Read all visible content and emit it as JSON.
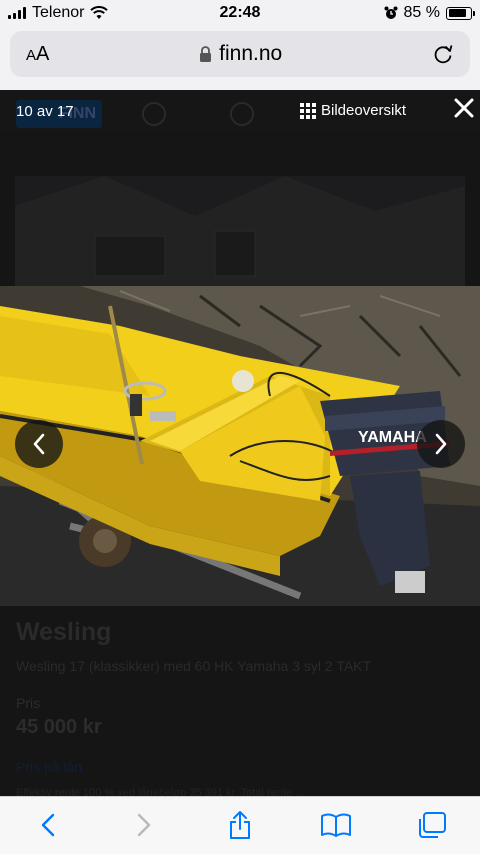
{
  "status_bar": {
    "carrier": "Telenor",
    "time": "22:48",
    "battery_text": "85 %",
    "battery_level": 0.85
  },
  "browser": {
    "text_size_small": "A",
    "text_size_large": "A",
    "domain": "finn.no"
  },
  "gallery": {
    "counter": "10 av 17",
    "overview_label": "Bildeoversikt"
  },
  "listing": {
    "title": "Wesling",
    "description": "Wesling 17 (klassikker) med 60 HK Yamaha 3 syl 2 TAKT",
    "price_label": "Pris",
    "price": "45 000 kr",
    "loan_link": "Pris på lån",
    "fine_print": "Effektiv rente 100 % ved lånebeløp 35 391 kr. Total rente ..."
  },
  "photo": {
    "engine_brand": "YAMAHA"
  },
  "colors": {
    "accent": "#007aff",
    "boat_yellow": "#f2cf1b",
    "finn_blue": "#0a2540"
  }
}
